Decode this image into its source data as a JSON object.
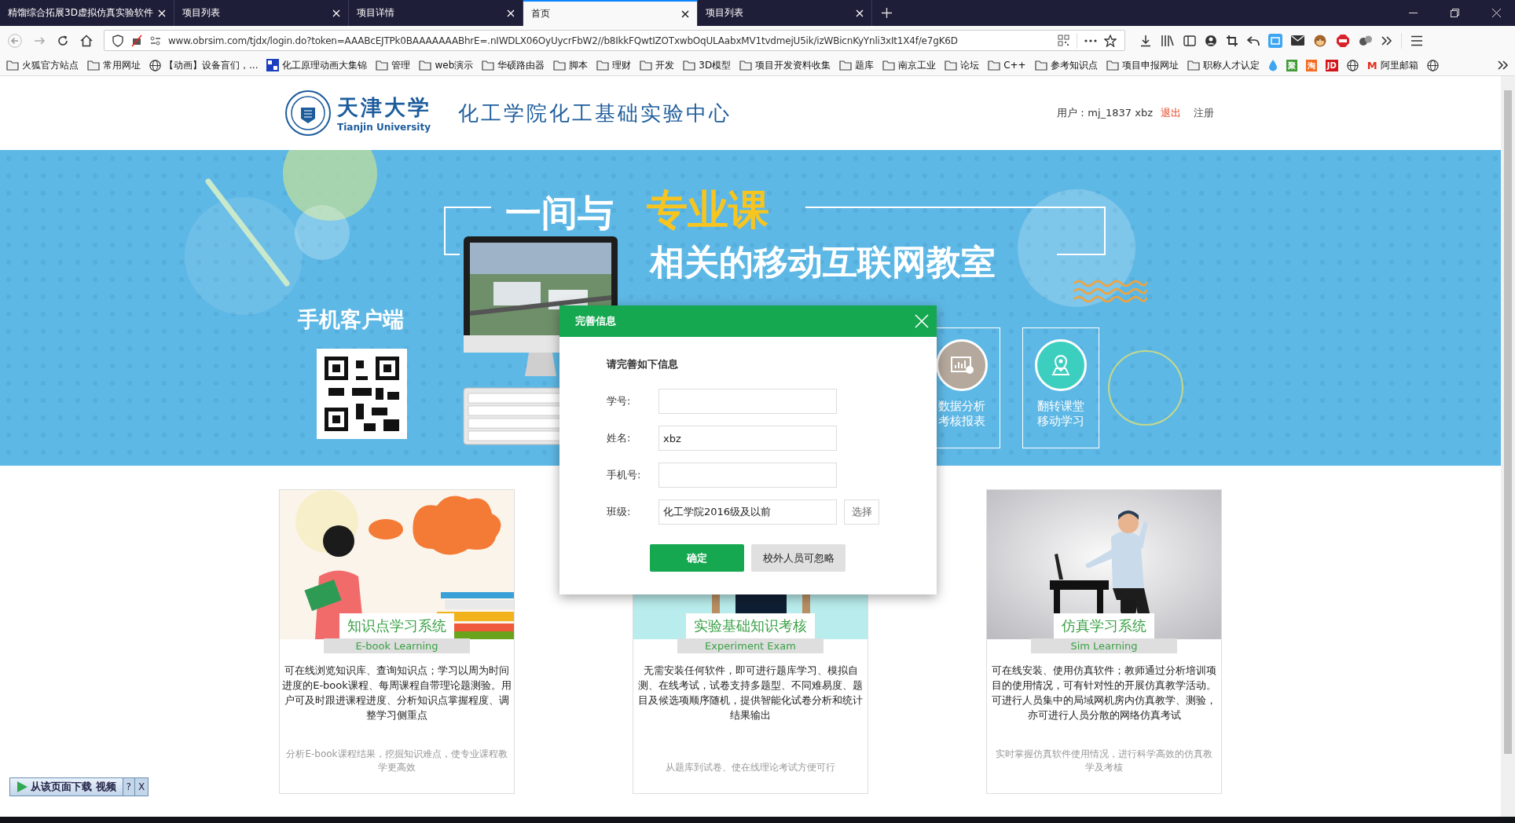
{
  "browser": {
    "tabs": [
      {
        "title": "精馏综合拓展3D虚拟仿真实验软件",
        "selected": false
      },
      {
        "title": "项目列表",
        "selected": false
      },
      {
        "title": "项目详情",
        "selected": false
      },
      {
        "title": "首页",
        "selected": true
      },
      {
        "title": "项目列表",
        "selected": false
      }
    ],
    "url": "www.obrsim.com/tjdx/login.do?token=AAABcEJTPk0BAAAAAAABhrE=.nIWDLX06OyUycrFbW2//b8IkkFQwtIZOTxwbOqULAabxMV1tvdmejU5ik/izWBicnKyYnli3xIt1X4f/e7gK6D",
    "bookmarks": [
      {
        "kind": "folder",
        "label": "火狐官方站点"
      },
      {
        "kind": "folder",
        "label": "常用网址"
      },
      {
        "kind": "globe",
        "label": "【动画】设备盲们，..."
      },
      {
        "kind": "grid",
        "label": "化工原理动画大集锦"
      },
      {
        "kind": "folder",
        "label": "管理"
      },
      {
        "kind": "folder",
        "label": "web演示"
      },
      {
        "kind": "folder",
        "label": "华硕路由器"
      },
      {
        "kind": "folder",
        "label": "脚本"
      },
      {
        "kind": "folder",
        "label": "理财"
      },
      {
        "kind": "folder",
        "label": "开发"
      },
      {
        "kind": "folder",
        "label": "3D模型"
      },
      {
        "kind": "folder",
        "label": "项目开发资料收集"
      },
      {
        "kind": "folder",
        "label": "题库"
      },
      {
        "kind": "folder",
        "label": "南京工业"
      },
      {
        "kind": "folder",
        "label": "论坛"
      },
      {
        "kind": "folder",
        "label": "C++"
      },
      {
        "kind": "folder",
        "label": "参考知识点"
      },
      {
        "kind": "folder",
        "label": "项目申报网址"
      },
      {
        "kind": "folder",
        "label": "职称人才认定"
      },
      {
        "kind": "drop"
      },
      {
        "kind": "badge",
        "icon_text": "聚",
        "color": "#3f9a35"
      },
      {
        "kind": "badge",
        "icon_text": "淘",
        "color": "#f46a1f"
      },
      {
        "kind": "badge",
        "icon_text": "JD",
        "color": "#d4151b"
      },
      {
        "kind": "globe"
      },
      {
        "kind": "letter",
        "icon_text": "M",
        "color": "#e0301e",
        "label": "阿里邮箱"
      },
      {
        "kind": "globe"
      }
    ]
  },
  "header": {
    "logo_cn": "天津大学",
    "logo_en": "Tianjin University",
    "site_title": "化工学院化工基础实验中心",
    "user_label": "用户：mj_1837 xbz",
    "logout": "退出",
    "register": "注册"
  },
  "banner": {
    "mobile_title": "手机客户端",
    "headline_lead": "一间与",
    "headline_highlight": "专业课",
    "headline_rest": "相关的移动互联网教室",
    "features": [
      {
        "kind": "chart",
        "line_1": "数据分析",
        "line_2": "考核报表",
        "color": "#b5a89c"
      },
      {
        "kind": "pin",
        "line_1": "翻转课堂",
        "line_2": "移动学习",
        "color": "#3ccfc0"
      }
    ]
  },
  "cards": [
    {
      "kind": "ebook",
      "title": "知识点学习系统",
      "subtitle": "E-book Learning",
      "description": "可在线浏览知识库、查询知识点；学习以周为时间进度的E-book课程、每周课程自带理论题测验。用户可及时跟进课程进度、分析知识点掌握程度、调整学习侧重点",
      "note": "分析E-book课程结果，挖掘知识难点，使专业课程教学更高效"
    },
    {
      "kind": "exam",
      "title": "实验基础知识考核",
      "subtitle": "Experiment Exam",
      "description": "无需安装任何软件，即可进行题库学习、模拟自测、在线考试，试卷支持多题型、不同难易度、题目及候选项顺序随机，提供智能化试卷分析和统计结果输出",
      "note": "从题库到试卷、使在线理论考试方便可行"
    },
    {
      "kind": "sim",
      "title": "仿真学习系统",
      "subtitle": "Sim Learning",
      "description": "可在线安装、使用仿真软件；教师通过分析培训项目的使用情况，可有针对性的开展仿真教学活动。可进行人员集中的局域网机房内仿真教学、测验，亦可进行人员分散的网络仿真考试",
      "note": "实时掌握仿真软件使用情况，进行科学高效的仿真教学及考核"
    }
  ],
  "dialog": {
    "title": "完善信息",
    "prompt": "请完善如下信息",
    "fields": [
      {
        "label": "学号:"
      },
      {
        "label": "姓名:",
        "value": "xbz"
      },
      {
        "label": "手机号:"
      },
      {
        "label": "班级:",
        "value": "化工学院2016级及以前",
        "action": "选择"
      }
    ],
    "confirm": "确定",
    "skip": "校外人员可忽略"
  },
  "download_bar": {
    "label": "从该页面下载 视频",
    "help": "?",
    "close": "X"
  }
}
